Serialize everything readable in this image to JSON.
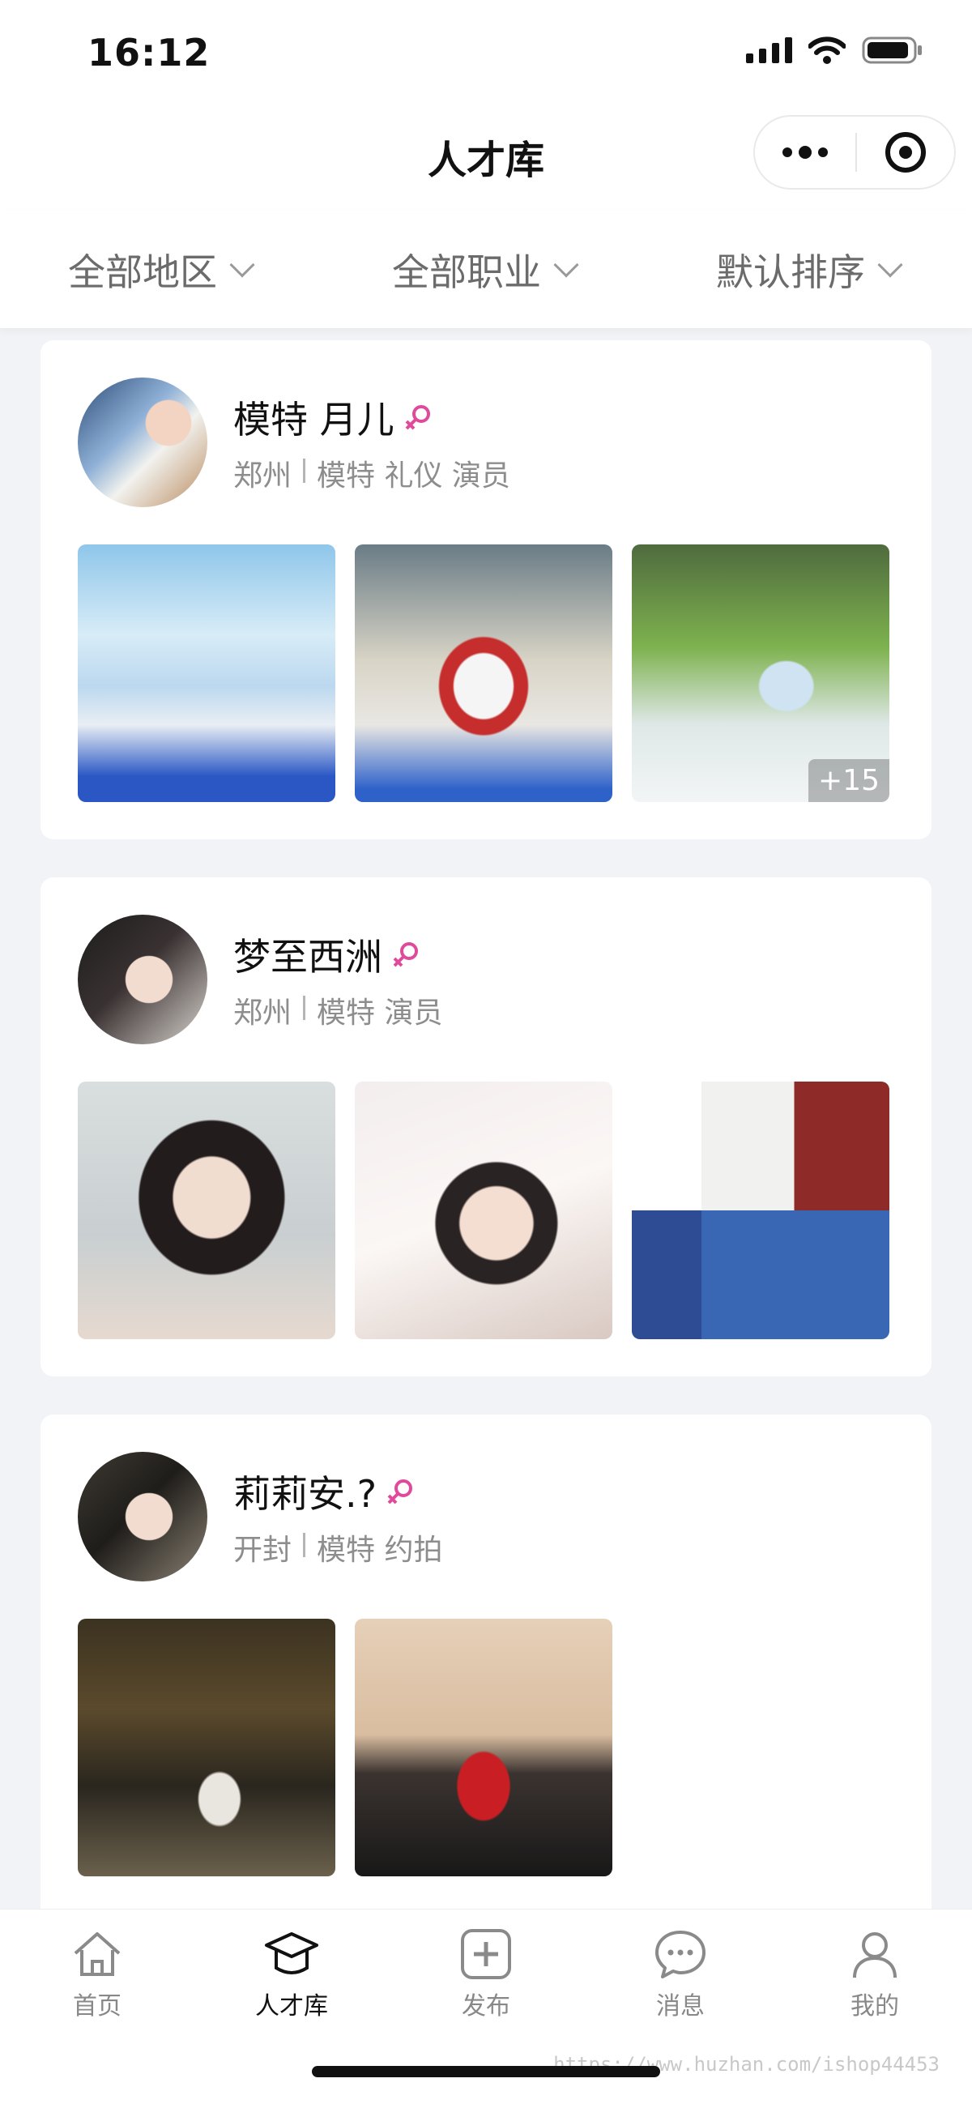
{
  "status_bar": {
    "time": "16:12"
  },
  "nav": {
    "title": "人才库"
  },
  "filters": [
    {
      "label": "全部地区"
    },
    {
      "label": "全部职业"
    },
    {
      "label": "默认排序"
    }
  ],
  "cards": [
    {
      "name": "模特 月儿",
      "city": "郑州",
      "roles": "模特 礼仪 演员",
      "photo_overflow": "+15"
    },
    {
      "name": "梦至西洲",
      "city": "郑州",
      "roles": "模特 演员",
      "photo_overflow": ""
    },
    {
      "name": "莉莉安.?",
      "city": "开封",
      "roles": "模特 约拍",
      "photo_overflow": ""
    }
  ],
  "tabs": [
    {
      "label": "首页"
    },
    {
      "label": "人才库"
    },
    {
      "label": "发布"
    },
    {
      "label": "消息"
    },
    {
      "label": "我的"
    }
  ],
  "watermark": "https://www.huzhan.com/ishop44453",
  "colors": {
    "female_icon": "#e04a9b",
    "active_tab": "#111111",
    "inactive_tab": "#888888"
  }
}
